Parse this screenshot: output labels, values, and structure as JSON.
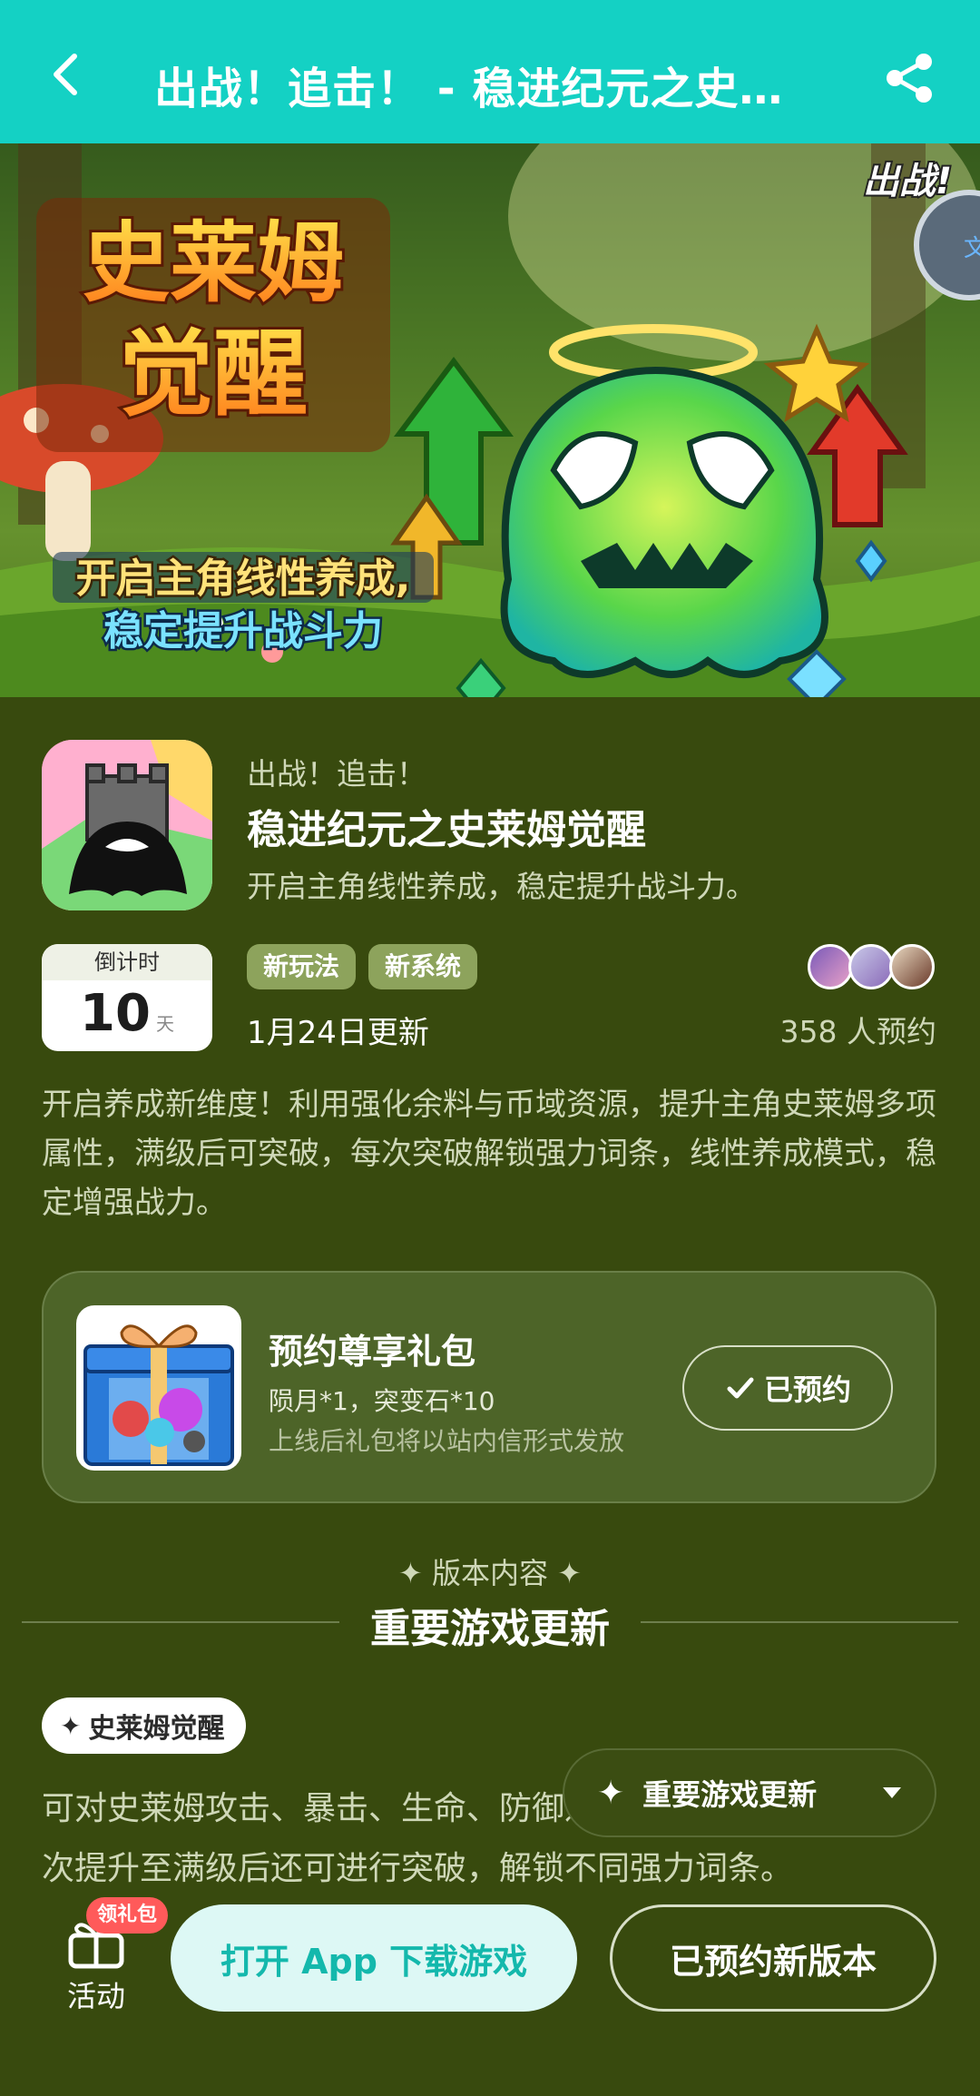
{
  "header": {
    "title": "出战！追击！ - 稳进纪元之史…",
    "back_icon": "chevron-left-icon",
    "share_icon": "share-icon",
    "background": "#14d1c4"
  },
  "banner": {
    "title_line1": "史莱姆",
    "title_line2": "觉醒",
    "subtitle_line1": "开启主角线性养成,",
    "subtitle_line2": "稳定提升战斗力",
    "corner_text": "出战!",
    "side_badge_text": "文"
  },
  "game": {
    "series": "出战！追击！",
    "name": "稳进纪元之史莱姆觉醒",
    "tagline": "开启主角线性养成，稳定提升战斗力。"
  },
  "countdown": {
    "label": "倒计时",
    "value": "10",
    "unit": "天"
  },
  "tags": [
    "新玩法",
    "新系统"
  ],
  "updated": "1月24日更新",
  "reservations": "358 人预约",
  "description": "开启养成新维度！利用强化余料与币域资源，提升主角史莱姆多项属性，满级后可突破，每次突破解锁强力词条，线性养成模式，稳定增强战力。",
  "gift": {
    "title": "预约尊享礼包",
    "items": "陨月*1，突变石*10",
    "note": "上线后礼包将以站内信形式发放",
    "button_label": "已预约"
  },
  "version": {
    "label": "✦ 版本内容 ✦",
    "title": "重要游戏更新",
    "chip_label": "史莱姆觉醒",
    "body": "可对史莱姆攻击、暴击、生命、防御进行强化，每一项属性每次提升至满级后还可进行突破，解锁不同强力词条。",
    "float_label": "重要游戏更新"
  },
  "bottom": {
    "activity_label": "活动",
    "gift_badge": "领礼包",
    "open_app_label": "打开 App 下载游戏",
    "reserved_label": "已预约新版本"
  }
}
